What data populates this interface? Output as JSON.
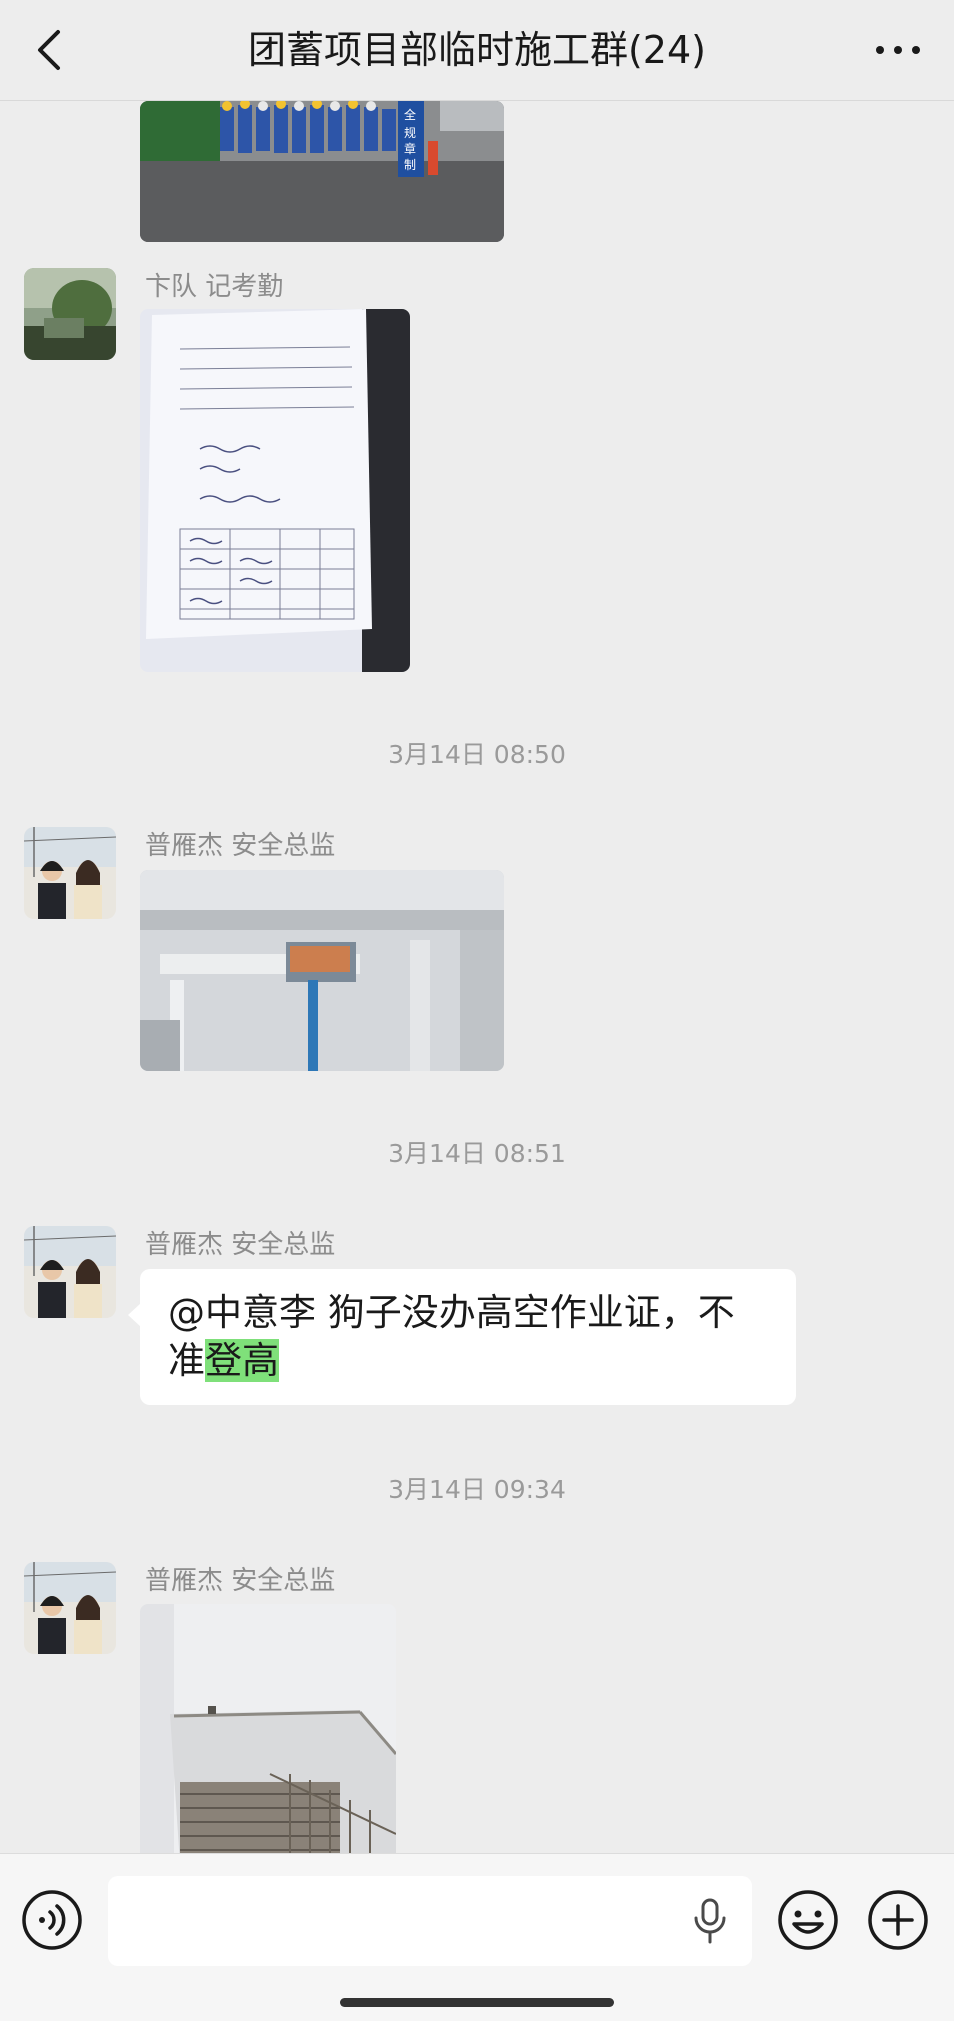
{
  "header": {
    "title": "团蓄项目部临时施工群(24)",
    "back_icon": "chevron-left-icon",
    "more_icon": "more-horizontal-icon"
  },
  "messages": [
    {
      "type": "image",
      "content": "group photo of construction workers in blue uniforms",
      "sign_text": "全规章制度"
    },
    {
      "type": "image",
      "sender": "卞队 记考勤",
      "content": "photo of attendance sheet"
    },
    {
      "type": "timestamp",
      "text": "3月14日 08:50"
    },
    {
      "type": "image",
      "sender": "普雁杰  安全总监",
      "content": "photo of aerial work platform lift inside building"
    },
    {
      "type": "timestamp",
      "text": "3月14日 08:51"
    },
    {
      "type": "text",
      "sender": "普雁杰  安全总监",
      "text_before": "@中意李  狗子没办高空作业证，不准",
      "text_highlight": "登高"
    },
    {
      "type": "timestamp",
      "text": "3月14日 09:34"
    },
    {
      "type": "image",
      "sender": "普雁杰  安全总监",
      "content": "photo of staircase opening in building"
    }
  ],
  "input_bar": {
    "voice_icon": "voice-input-icon",
    "mic_icon": "microphone-icon",
    "emoji_icon": "emoji-icon",
    "plus_icon": "plus-circle-icon"
  },
  "colors": {
    "background": "#ededed",
    "bubble": "#ffffff",
    "highlight": "#7fe07a"
  }
}
